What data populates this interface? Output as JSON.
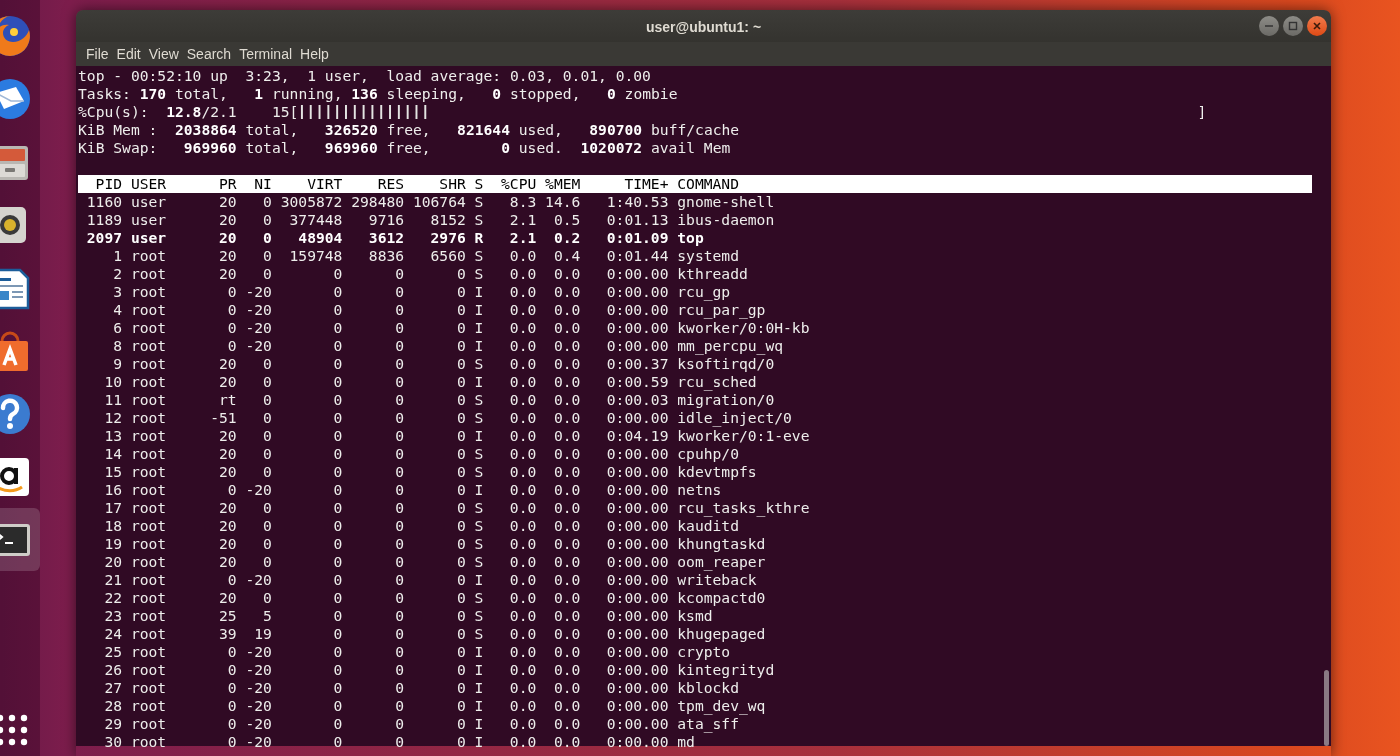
{
  "dock": {
    "items": [
      {
        "kind": "browser",
        "selected": false
      },
      {
        "kind": "mail",
        "selected": false
      },
      {
        "kind": "files",
        "selected": false
      },
      {
        "kind": "music",
        "selected": false
      },
      {
        "kind": "document",
        "selected": false
      },
      {
        "kind": "store",
        "selected": false
      },
      {
        "kind": "help",
        "selected": false
      },
      {
        "kind": "shop",
        "selected": false
      },
      {
        "kind": "terminal",
        "selected": true
      }
    ]
  },
  "window": {
    "title": "user@ubuntu1: ~"
  },
  "menu": [
    "File",
    "Edit",
    "View",
    "Search",
    "Terminal",
    "Help"
  ],
  "terminal": {
    "summary": [
      {
        "kind": "text",
        "text": "top - 00:52:10 up  3:23,  1 user,  load average: 0.03, 0.01, 0.00"
      },
      {
        "kind": "text",
        "text": "Tasks: **170** total,   **1** running, **136** sleeping,   **0** stopped,   **0** zombie"
      },
      {
        "kind": "meter",
        "text": "%Cpu(s):  **12.8**/2.1    15",
        "open": "[",
        "close": "]",
        "level": 0.15
      },
      {
        "kind": "text",
        "text": "KiB Mem :  **2038864** total,   **326520** free,   **821644** used,   **890700** buff/cache"
      },
      {
        "kind": "text",
        "text": "KiB Swap:   **969960** total,   **969960** free,        **0** used.  **1020072** avail Mem"
      }
    ],
    "columns": [
      "PID",
      "USER",
      "PR",
      "NI",
      "VIRT",
      "RES",
      "SHR",
      "S",
      "%CPU",
      "%MEM",
      "TIME+",
      "COMMAND"
    ],
    "rows": [
      {
        "cells": [
          "1160",
          "user",
          "20",
          "0",
          "3005872",
          "298480",
          "106764",
          "S",
          "8.3",
          "14.6",
          "1:40.53",
          "gnome-shell"
        ],
        "highlighted": false
      },
      {
        "cells": [
          "1189",
          "user",
          "20",
          "0",
          "377448",
          "9716",
          "8152",
          "S",
          "2.1",
          "0.5",
          "0:01.13",
          "ibus-daemon"
        ],
        "highlighted": false
      },
      {
        "cells": [
          "2097",
          "user",
          "20",
          "0",
          "48904",
          "3612",
          "2976",
          "R",
          "2.1",
          "0.2",
          "0:01.09",
          "top"
        ],
        "highlighted": true
      },
      {
        "cells": [
          "1",
          "root",
          "20",
          "0",
          "159748",
          "8836",
          "6560",
          "S",
          "0.0",
          "0.4",
          "0:01.44",
          "systemd"
        ],
        "highlighted": false
      },
      {
        "cells": [
          "2",
          "root",
          "20",
          "0",
          "0",
          "0",
          "0",
          "S",
          "0.0",
          "0.0",
          "0:00.00",
          "kthreadd"
        ],
        "highlighted": false
      },
      {
        "cells": [
          "3",
          "root",
          "0",
          "-20",
          "0",
          "0",
          "0",
          "I",
          "0.0",
          "0.0",
          "0:00.00",
          "rcu_gp"
        ],
        "highlighted": false
      },
      {
        "cells": [
          "4",
          "root",
          "0",
          "-20",
          "0",
          "0",
          "0",
          "I",
          "0.0",
          "0.0",
          "0:00.00",
          "rcu_par_gp"
        ],
        "highlighted": false
      },
      {
        "cells": [
          "6",
          "root",
          "0",
          "-20",
          "0",
          "0",
          "0",
          "I",
          "0.0",
          "0.0",
          "0:00.00",
          "kworker/0:0H-kb"
        ],
        "highlighted": false
      },
      {
        "cells": [
          "8",
          "root",
          "0",
          "-20",
          "0",
          "0",
          "0",
          "I",
          "0.0",
          "0.0",
          "0:00.00",
          "mm_percpu_wq"
        ],
        "highlighted": false
      },
      {
        "cells": [
          "9",
          "root",
          "20",
          "0",
          "0",
          "0",
          "0",
          "S",
          "0.0",
          "0.0",
          "0:00.37",
          "ksoftirqd/0"
        ],
        "highlighted": false
      },
      {
        "cells": [
          "10",
          "root",
          "20",
          "0",
          "0",
          "0",
          "0",
          "I",
          "0.0",
          "0.0",
          "0:00.59",
          "rcu_sched"
        ],
        "highlighted": false
      },
      {
        "cells": [
          "11",
          "root",
          "rt",
          "0",
          "0",
          "0",
          "0",
          "S",
          "0.0",
          "0.0",
          "0:00.03",
          "migration/0"
        ],
        "highlighted": false
      },
      {
        "cells": [
          "12",
          "root",
          "-51",
          "0",
          "0",
          "0",
          "0",
          "S",
          "0.0",
          "0.0",
          "0:00.00",
          "idle_inject/0"
        ],
        "highlighted": false
      },
      {
        "cells": [
          "13",
          "root",
          "20",
          "0",
          "0",
          "0",
          "0",
          "I",
          "0.0",
          "0.0",
          "0:04.19",
          "kworker/0:1-eve"
        ],
        "highlighted": false
      },
      {
        "cells": [
          "14",
          "root",
          "20",
          "0",
          "0",
          "0",
          "0",
          "S",
          "0.0",
          "0.0",
          "0:00.00",
          "cpuhp/0"
        ],
        "highlighted": false
      },
      {
        "cells": [
          "15",
          "root",
          "20",
          "0",
          "0",
          "0",
          "0",
          "S",
          "0.0",
          "0.0",
          "0:00.00",
          "kdevtmpfs"
        ],
        "highlighted": false
      },
      {
        "cells": [
          "16",
          "root",
          "0",
          "-20",
          "0",
          "0",
          "0",
          "I",
          "0.0",
          "0.0",
          "0:00.00",
          "netns"
        ],
        "highlighted": false
      },
      {
        "cells": [
          "17",
          "root",
          "20",
          "0",
          "0",
          "0",
          "0",
          "S",
          "0.0",
          "0.0",
          "0:00.00",
          "rcu_tasks_kthre"
        ],
        "highlighted": false
      },
      {
        "cells": [
          "18",
          "root",
          "20",
          "0",
          "0",
          "0",
          "0",
          "S",
          "0.0",
          "0.0",
          "0:00.00",
          "kauditd"
        ],
        "highlighted": false
      },
      {
        "cells": [
          "19",
          "root",
          "20",
          "0",
          "0",
          "0",
          "0",
          "S",
          "0.0",
          "0.0",
          "0:00.00",
          "khungtaskd"
        ],
        "highlighted": false
      },
      {
        "cells": [
          "20",
          "root",
          "20",
          "0",
          "0",
          "0",
          "0",
          "S",
          "0.0",
          "0.0",
          "0:00.00",
          "oom_reaper"
        ],
        "highlighted": false
      },
      {
        "cells": [
          "21",
          "root",
          "0",
          "-20",
          "0",
          "0",
          "0",
          "I",
          "0.0",
          "0.0",
          "0:00.00",
          "writeback"
        ],
        "highlighted": false
      },
      {
        "cells": [
          "22",
          "root",
          "20",
          "0",
          "0",
          "0",
          "0",
          "S",
          "0.0",
          "0.0",
          "0:00.00",
          "kcompactd0"
        ],
        "highlighted": false
      },
      {
        "cells": [
          "23",
          "root",
          "25",
          "5",
          "0",
          "0",
          "0",
          "S",
          "0.0",
          "0.0",
          "0:00.00",
          "ksmd"
        ],
        "highlighted": false
      },
      {
        "cells": [
          "24",
          "root",
          "39",
          "19",
          "0",
          "0",
          "0",
          "S",
          "0.0",
          "0.0",
          "0:00.00",
          "khugepaged"
        ],
        "highlighted": false
      },
      {
        "cells": [
          "25",
          "root",
          "0",
          "-20",
          "0",
          "0",
          "0",
          "I",
          "0.0",
          "0.0",
          "0:00.00",
          "crypto"
        ],
        "highlighted": false
      },
      {
        "cells": [
          "26",
          "root",
          "0",
          "-20",
          "0",
          "0",
          "0",
          "I",
          "0.0",
          "0.0",
          "0:00.00",
          "kintegrityd"
        ],
        "highlighted": false
      },
      {
        "cells": [
          "27",
          "root",
          "0",
          "-20",
          "0",
          "0",
          "0",
          "I",
          "0.0",
          "0.0",
          "0:00.00",
          "kblockd"
        ],
        "highlighted": false
      },
      {
        "cells": [
          "28",
          "root",
          "0",
          "-20",
          "0",
          "0",
          "0",
          "I",
          "0.0",
          "0.0",
          "0:00.00",
          "tpm_dev_wq"
        ],
        "highlighted": false
      },
      {
        "cells": [
          "29",
          "root",
          "0",
          "-20",
          "0",
          "0",
          "0",
          "I",
          "0.0",
          "0.0",
          "0:00.00",
          "ata_sff"
        ],
        "highlighted": false
      },
      {
        "cells": [
          "30",
          "root",
          "0",
          "-20",
          "0",
          "0",
          "0",
          "I",
          "0.0",
          "0.0",
          "0:00.00",
          "md"
        ],
        "highlighted": false
      }
    ]
  }
}
